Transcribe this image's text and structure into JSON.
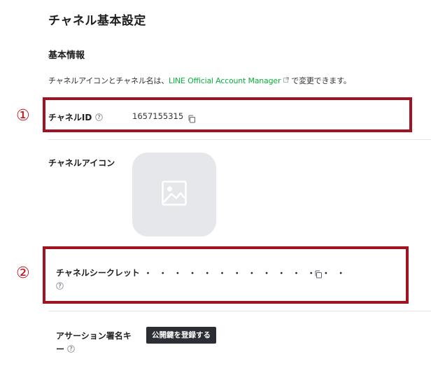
{
  "page": {
    "title": "チャネル基本設定"
  },
  "basic_info": {
    "section_title": "基本情報",
    "description_before": "チャネルアイコンとチャネル名は、",
    "description_link": "LINE Official Account Manager",
    "description_after": "で変更できます。"
  },
  "channel_id": {
    "marker": "①",
    "label": "チャネルID",
    "value": "1657155315"
  },
  "channel_icon": {
    "label": "チャネルアイコン"
  },
  "channel_secret": {
    "marker": "②",
    "label": "チャネルシークレット",
    "masked_value": "・・・・・・・・・・・・・・"
  },
  "assertion_key": {
    "label": "アサーション署名キー",
    "button_label": "公開鍵を登録する"
  },
  "colors": {
    "link": "#06b43c",
    "highlight_box": "#a11320",
    "marker": "#c0101a",
    "button_bg": "#2b2e33"
  }
}
